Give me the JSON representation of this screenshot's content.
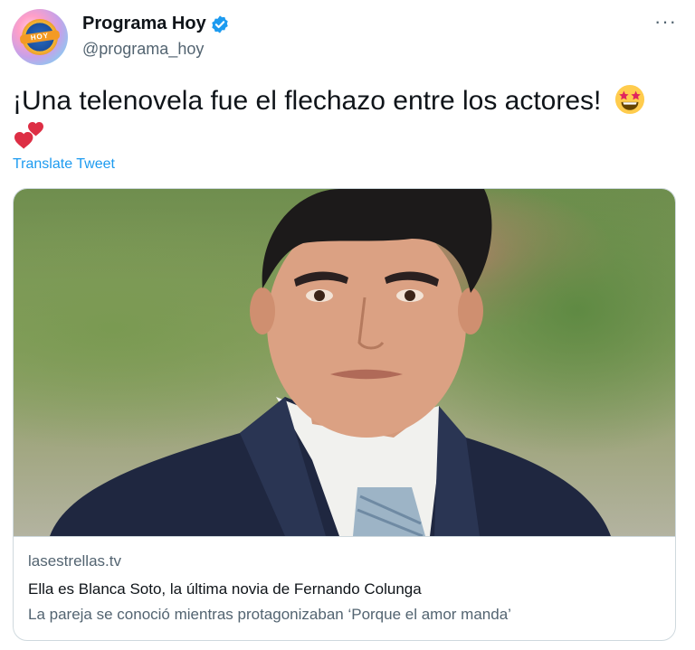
{
  "author": {
    "display_name": "Programa Hoy",
    "handle": "@programa_hoy",
    "avatar_text": "HOY",
    "verified": true
  },
  "more_label": "···",
  "tweet": {
    "text": "¡Una telenovela fue el flechazo entre los actores!",
    "emojis": [
      "star-struck-emoji",
      "two-hearts-emoji"
    ],
    "translate_label": "Translate Tweet"
  },
  "card": {
    "domain": "lasestrellas.tv",
    "title": "Ella es Blanca Soto, la última novia de Fernando Colunga",
    "description": "La pareja se conoció mientras protagonizaban ‘Porque el amor manda’"
  },
  "colors": {
    "accent": "#1d9bf0",
    "text": "#0f1419",
    "secondary": "#536471",
    "border": "#cfd9de"
  }
}
